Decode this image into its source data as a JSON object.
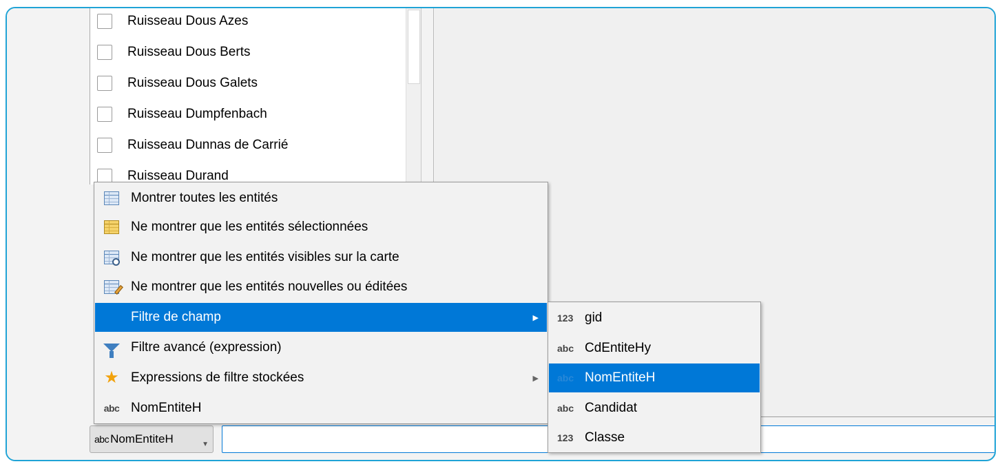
{
  "feature_list": {
    "items": [
      {
        "label": "Ruisseau Dous Azes"
      },
      {
        "label": "Ruisseau Dous Berts"
      },
      {
        "label": "Ruisseau Dous Galets"
      },
      {
        "label": "Ruisseau Dumpfenbach"
      },
      {
        "label": "Ruisseau Dunnas de Carrié"
      },
      {
        "label": "Ruisseau Durand"
      }
    ]
  },
  "context_menu": {
    "items": [
      {
        "label": "Montrer toutes les entités",
        "icon": "table-icon"
      },
      {
        "label": "Ne montrer que les entités sélectionnées",
        "icon": "selected-table-icon"
      },
      {
        "label": "Ne montrer que les entités visibles sur la carte",
        "icon": "visible-table-icon"
      },
      {
        "label": "Ne montrer que les entités nouvelles ou éditées",
        "icon": "edited-table-icon"
      },
      {
        "label": "Filtre de champ",
        "icon": "none",
        "submenu": true,
        "highlighted": true
      },
      {
        "label": "Filtre avancé (expression)",
        "icon": "funnel-icon"
      },
      {
        "label": "Expressions de filtre stockées",
        "icon": "star-icon",
        "submenu": true
      },
      {
        "label": "NomEntiteH",
        "icon": "text-field-icon",
        "prefix": "abc"
      }
    ]
  },
  "field_submenu": {
    "items": [
      {
        "type": "123",
        "label": "gid"
      },
      {
        "type": "abc",
        "label": "CdEntiteHy"
      },
      {
        "type": "abc",
        "label": "NomEntiteH",
        "highlighted": true
      },
      {
        "type": "abc",
        "label": "Candidat"
      },
      {
        "type": "123",
        "label": "Classe"
      }
    ]
  },
  "bottom_bar": {
    "field_combo_prefix": "abc",
    "field_combo_value": "NomEntiteH",
    "filter_input_value": ""
  },
  "colors": {
    "highlight": "#0078d7",
    "frame_border": "#1fa3d6"
  }
}
